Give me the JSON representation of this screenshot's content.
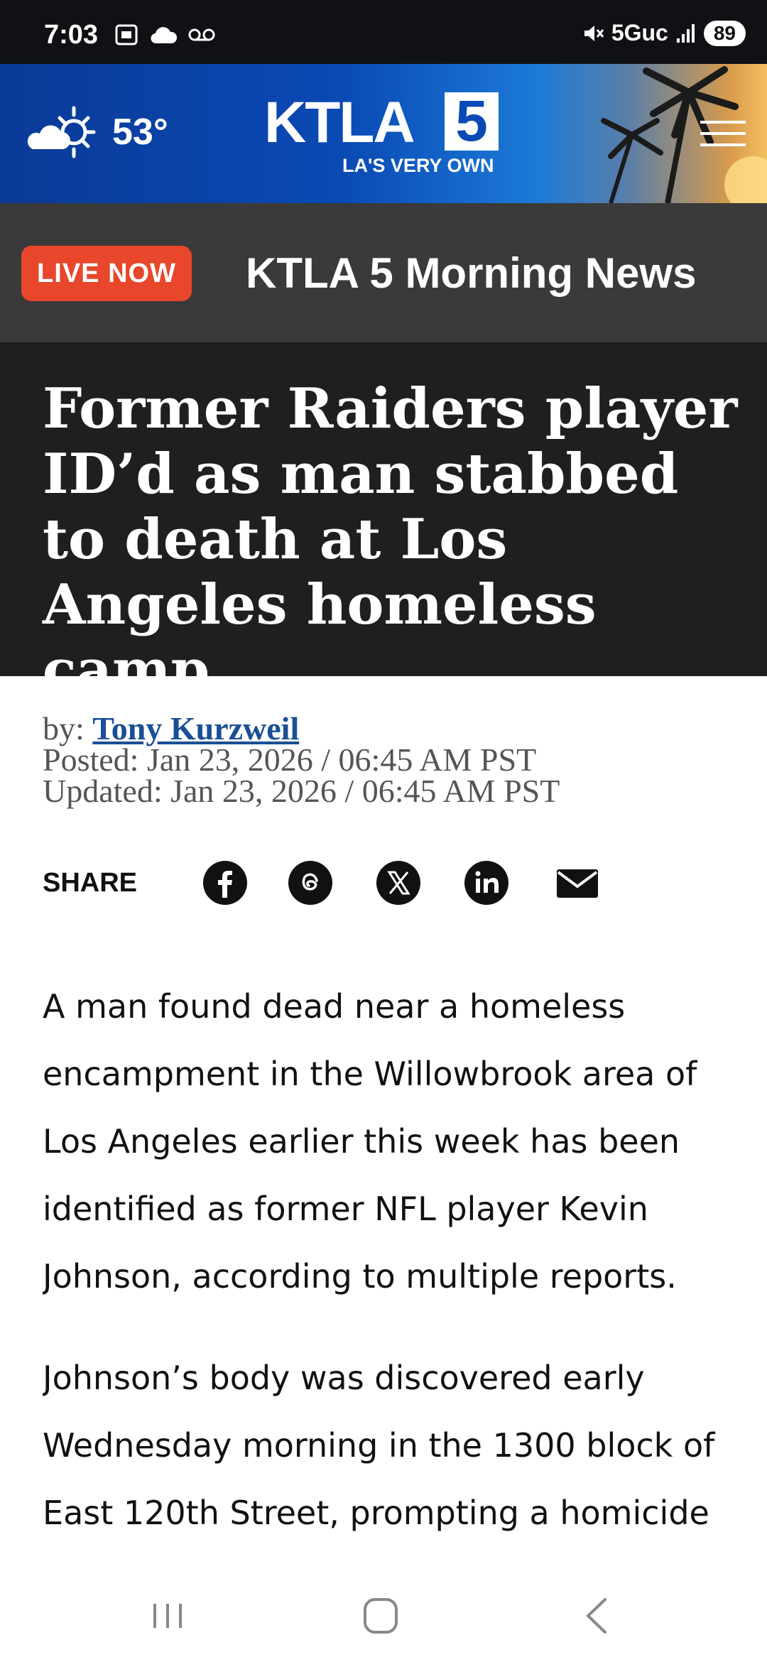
{
  "status_bar": {
    "time": "7:03",
    "network": "5Guc",
    "battery": "89"
  },
  "header": {
    "temperature": "53°",
    "logo_text": "KTLA",
    "logo_number": "5",
    "tagline": "LA'S VERY OWN",
    "menu_icon": "hamburger-menu-icon"
  },
  "live": {
    "badge": "LIVE NOW",
    "title": "KTLA 5 Morning News",
    "badge_color": "#e8472b"
  },
  "article": {
    "headline": "Former Raiders player ID’d as man stabbed to death at Los Angeles homeless camp",
    "byline_prefix": "by: ",
    "author": "Tony Kurzweil",
    "posted": "Posted: Jan 23, 2026 / 06:45 AM PST",
    "updated": "Updated: Jan 23, 2026 / 06:45 AM PST",
    "share_label": "SHARE",
    "share_icons": [
      "facebook-icon",
      "threads-icon",
      "x-icon",
      "linkedin-icon",
      "email-icon"
    ],
    "paragraphs": [
      "A man found dead near a homeless encampment in the Willowbrook area of Los Angeles earlier this week has been identified as former NFL player Kevin Johnson, according to multiple reports.",
      "Johnson’s body was discovered early Wednesday morning in the 1300 block of East 120th Street, prompting a homicide investigation."
    ]
  },
  "colors": {
    "header_blue": "#0a4ab5",
    "headline_bg": "#1f1f1f",
    "link": "#1a4f95"
  }
}
